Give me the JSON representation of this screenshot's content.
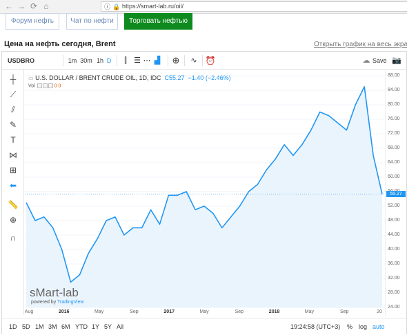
{
  "browser": {
    "url": "https://smart-lab.ru/oil/"
  },
  "page": {
    "buttons": {
      "forum": "Форум нефть",
      "chat": "Чат по нефти",
      "trade": "Торговать нефтью"
    },
    "title": "Цена на нефть сегодня, Brent",
    "fullscreen_link": "Открыть график на весь экран"
  },
  "toolbar": {
    "symbol": "USDBRO",
    "intervals": [
      "1m",
      "30m",
      "1h",
      "D"
    ],
    "active_interval": "D",
    "save_label": "Save"
  },
  "legend": {
    "name": "U.S. DOLLAR / BRENT CRUDE OIL, 1D, IDC",
    "close": "C55.27",
    "change": "−1.40",
    "change_pct": "(−2.46%)",
    "vol_label": "Vol",
    "vol_values": [
      "0",
      "0"
    ]
  },
  "watermark": {
    "brand": "sMart-lab",
    "powered_prefix": "powered by",
    "powered_brand": "TradingView"
  },
  "bottom_bar": {
    "ranges": [
      "1D",
      "5D",
      "1M",
      "3M",
      "6M",
      "YTD",
      "1Y",
      "5Y",
      "All"
    ],
    "time": "19:24:58 (UTC+3)",
    "percent": "%",
    "log": "log",
    "auto": "auto"
  },
  "colors": {
    "line": "#2196f3",
    "area": "#eaf4fd",
    "trade_button": "#0e8a1f"
  },
  "chart_data": {
    "type": "area",
    "ylim": [
      24,
      88
    ],
    "y_ticks": [
      "88.00",
      "84.00",
      "80.00",
      "76.00",
      "72.00",
      "68.00",
      "64.00",
      "60.00",
      "56.00",
      "52.00",
      "48.00",
      "44.00",
      "40.00",
      "36.00",
      "32.00",
      "28.00",
      "24.00"
    ],
    "x_ticks": [
      "Aug",
      "2016",
      "May",
      "Sep",
      "2017",
      "May",
      "Sep",
      "2018",
      "May",
      "Sep",
      "20"
    ],
    "last_price": "55.27",
    "x": [
      "2015-08",
      "2015-09",
      "2015-10",
      "2015-11",
      "2015-12",
      "2016-01",
      "2016-02",
      "2016-03",
      "2016-04",
      "2016-05",
      "2016-06",
      "2016-07",
      "2016-08",
      "2016-09",
      "2016-10",
      "2016-11",
      "2016-12",
      "2017-01",
      "2017-02",
      "2017-03",
      "2017-04",
      "2017-05",
      "2017-06",
      "2017-07",
      "2017-08",
      "2017-09",
      "2017-10",
      "2017-11",
      "2017-12",
      "2018-01",
      "2018-02",
      "2018-03",
      "2018-04",
      "2018-05",
      "2018-06",
      "2018-07",
      "2018-08",
      "2018-09",
      "2018-10",
      "2018-11",
      "2018-12"
    ],
    "values": [
      53,
      48,
      49,
      46,
      40,
      31,
      33,
      39,
      43,
      48,
      49,
      44,
      46,
      46,
      51,
      47,
      55,
      55,
      56,
      51,
      52,
      50,
      46,
      49,
      52,
      56,
      58,
      62,
      65,
      69,
      66,
      69,
      73,
      78,
      77,
      75,
      73,
      80,
      85,
      66,
      55.27
    ]
  }
}
